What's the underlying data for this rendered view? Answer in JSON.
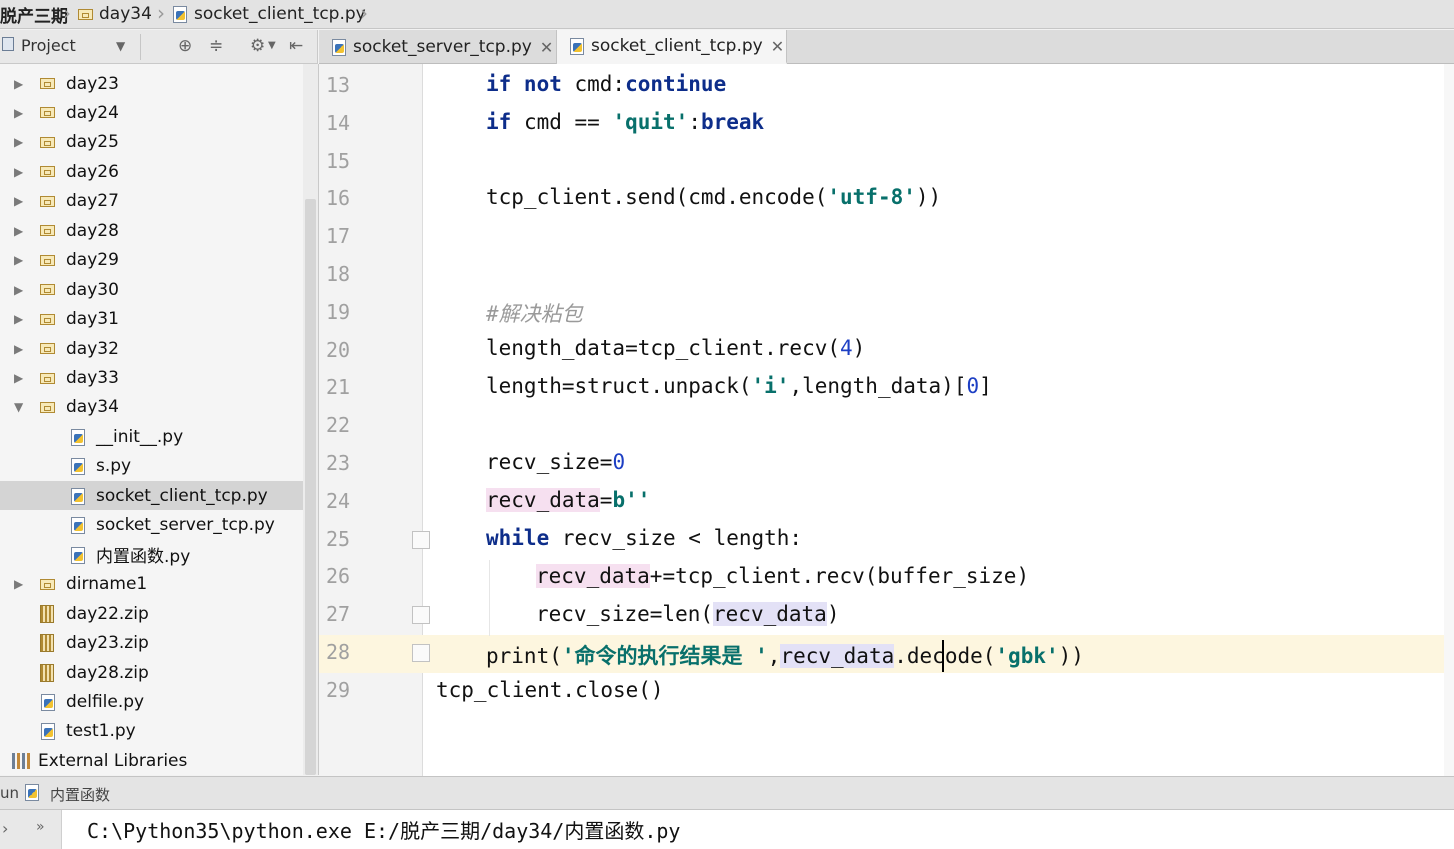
{
  "breadcrumb": {
    "items": [
      {
        "label": "脱产三期",
        "icon": "folder-icon"
      },
      {
        "label": "day34",
        "icon": "folder-icon"
      },
      {
        "label": "socket_client_tcp.py",
        "icon": "python-file-icon"
      }
    ]
  },
  "project_panel": {
    "title": "Project",
    "toolbar_icons": [
      "target-icon",
      "collapse-icon",
      "gear-icon",
      "hide-panel-icon"
    ]
  },
  "tabs": [
    {
      "label": "socket_server_tcp.py",
      "active": false
    },
    {
      "label": "socket_client_tcp.py",
      "active": true
    }
  ],
  "tree": {
    "items": [
      {
        "label": "day23",
        "type": "folder",
        "expanded": false
      },
      {
        "label": "day24",
        "type": "folder",
        "expanded": false
      },
      {
        "label": "day25",
        "type": "folder",
        "expanded": false
      },
      {
        "label": "day26",
        "type": "folder",
        "expanded": false
      },
      {
        "label": "day27",
        "type": "folder",
        "expanded": false
      },
      {
        "label": "day28",
        "type": "folder",
        "expanded": false
      },
      {
        "label": "day29",
        "type": "folder",
        "expanded": false
      },
      {
        "label": "day30",
        "type": "folder",
        "expanded": false
      },
      {
        "label": "day31",
        "type": "folder",
        "expanded": false
      },
      {
        "label": "day32",
        "type": "folder",
        "expanded": false
      },
      {
        "label": "day33",
        "type": "folder",
        "expanded": false
      },
      {
        "label": "day34",
        "type": "folder",
        "expanded": true
      },
      {
        "label": "__init__.py",
        "type": "py"
      },
      {
        "label": "s.py",
        "type": "py"
      },
      {
        "label": "socket_client_tcp.py",
        "type": "py",
        "selected": true
      },
      {
        "label": "socket_server_tcp.py",
        "type": "py"
      },
      {
        "label": "内置函数.py",
        "type": "py"
      },
      {
        "label": "dirname1",
        "type": "folder",
        "expanded": false
      },
      {
        "label": "day22.zip",
        "type": "zip"
      },
      {
        "label": "day23.zip",
        "type": "zip"
      },
      {
        "label": "day28.zip",
        "type": "zip"
      },
      {
        "label": "delfile.py",
        "type": "py"
      },
      {
        "label": "test1.py",
        "type": "py"
      },
      {
        "label": "External Libraries",
        "type": "lib"
      }
    ]
  },
  "editor": {
    "line_numbers": [
      "13",
      "14",
      "15",
      "16",
      "17",
      "18",
      "19",
      "20",
      "21",
      "22",
      "23",
      "24",
      "25",
      "26",
      "27",
      "28",
      "29"
    ],
    "current_line": "28",
    "lines": {
      "l13": {
        "kw1": "if not",
        "t1": " cmd:",
        "kw2": "continue"
      },
      "l14": {
        "kw1": "if",
        "t1": " cmd == ",
        "s1": "'quit'",
        "t2": ":",
        "kw2": "break"
      },
      "l16": {
        "t1": "tcp_client.send(cmd.encode(",
        "s1": "'utf-8'",
        "t2": "))"
      },
      "l19": {
        "c1": "#解决粘包"
      },
      "l20": {
        "t1": "length_data=tcp_client.recv(",
        "n1": "4",
        "t2": ")"
      },
      "l21": {
        "t1": "length=struct.unpack(",
        "s1": "'i'",
        "t2": ",length_data)[",
        "n1": "0",
        "t3": "]"
      },
      "l23": {
        "t1": "recv_size=",
        "n1": "0"
      },
      "l24": {
        "h1": "recv_data",
        "t1": "=",
        "s1": "b''"
      },
      "l25": {
        "kw1": "while",
        "t1": " recv_size < length:"
      },
      "l26": {
        "h1": "recv_data",
        "t1": "+=tcp_client.recv(buffer_size)"
      },
      "l27": {
        "t1": "recv_size=len(",
        "h1": "recv_data",
        "t2": ")"
      },
      "l28": {
        "t1": "print(",
        "s1": "'命令的执行结果是 '",
        "t2": ",",
        "h1": "recv_data",
        "t3": ".decode(",
        "s2": "'gbk'",
        "t4": "))"
      },
      "l29": {
        "t1": "tcp_client.close()"
      }
    }
  },
  "run_panel": {
    "prefix": "un",
    "title": "内置函数",
    "command": "C:\\Python35\\python.exe E:/脱产三期/day34/内置函数.py"
  }
}
